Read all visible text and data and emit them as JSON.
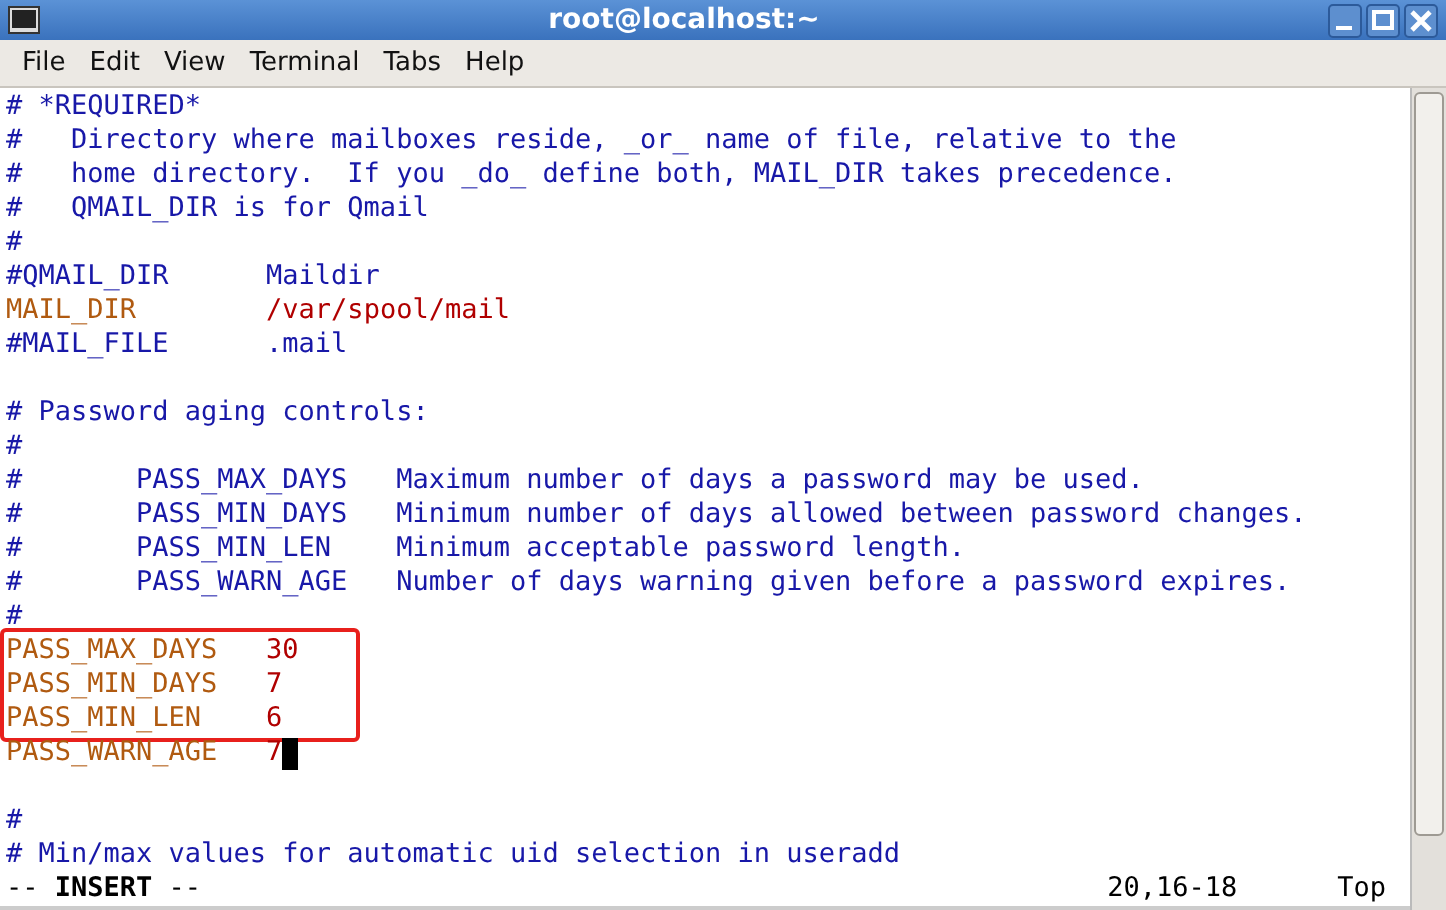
{
  "window": {
    "title": "root@localhost:~"
  },
  "menu": [
    {
      "label": "File"
    },
    {
      "label": "Edit"
    },
    {
      "label": "View"
    },
    {
      "label": "Terminal"
    },
    {
      "label": "Tabs"
    },
    {
      "label": "Help"
    }
  ],
  "blocks": [
    {
      "boxed": false,
      "lines": [
        {
          "kind": "code",
          "cursor": false,
          "segments": [
            {
              "kind": "comment",
              "text": "# *REQUIRED*"
            }
          ]
        },
        {
          "kind": "code",
          "cursor": false,
          "segments": [
            {
              "kind": "comment",
              "text": "#   Directory where mailboxes reside, _or_ name of file, relative to the"
            }
          ]
        },
        {
          "kind": "code",
          "cursor": false,
          "segments": [
            {
              "kind": "comment",
              "text": "#   home directory.  If you _do_ define both, MAIL_DIR takes precedence."
            }
          ]
        },
        {
          "kind": "code",
          "cursor": false,
          "segments": [
            {
              "kind": "comment",
              "text": "#   QMAIL_DIR is for Qmail"
            }
          ]
        },
        {
          "kind": "code",
          "cursor": false,
          "segments": [
            {
              "kind": "comment",
              "text": "#"
            }
          ]
        },
        {
          "kind": "code",
          "cursor": false,
          "segments": [
            {
              "kind": "comment",
              "text": "#QMAIL_DIR      Maildir"
            }
          ]
        },
        {
          "kind": "code",
          "cursor": false,
          "segments": [
            {
              "kind": "key",
              "text": "MAIL_DIR        "
            },
            {
              "kind": "value",
              "text": "/var/spool/mail"
            }
          ]
        },
        {
          "kind": "code",
          "cursor": false,
          "segments": [
            {
              "kind": "comment",
              "text": "#MAIL_FILE      .mail"
            }
          ]
        },
        {
          "kind": "blank"
        },
        {
          "kind": "code",
          "cursor": false,
          "segments": [
            {
              "kind": "comment",
              "text": "# Password aging controls:"
            }
          ]
        },
        {
          "kind": "code",
          "cursor": false,
          "segments": [
            {
              "kind": "comment",
              "text": "#"
            }
          ]
        },
        {
          "kind": "code",
          "cursor": false,
          "segments": [
            {
              "kind": "comment",
              "text": "#       PASS_MAX_DAYS   Maximum number of days a password may be used."
            }
          ]
        },
        {
          "kind": "code",
          "cursor": false,
          "segments": [
            {
              "kind": "comment",
              "text": "#       PASS_MIN_DAYS   Minimum number of days allowed between password changes."
            }
          ]
        },
        {
          "kind": "code",
          "cursor": false,
          "segments": [
            {
              "kind": "comment",
              "text": "#       PASS_MIN_LEN    Minimum acceptable password length."
            }
          ]
        },
        {
          "kind": "code",
          "cursor": false,
          "segments": [
            {
              "kind": "comment",
              "text": "#       PASS_WARN_AGE   Number of days warning given before a password expires."
            }
          ]
        },
        {
          "kind": "code",
          "cursor": false,
          "segments": [
            {
              "kind": "comment",
              "text": "#"
            }
          ]
        }
      ]
    },
    {
      "boxed": true,
      "lines": [
        {
          "kind": "code",
          "cursor": false,
          "segments": [
            {
              "kind": "key",
              "text": "PASS_MAX_DAYS   "
            },
            {
              "kind": "value",
              "text": "30"
            }
          ]
        },
        {
          "kind": "code",
          "cursor": false,
          "segments": [
            {
              "kind": "key",
              "text": "PASS_MIN_DAYS   "
            },
            {
              "kind": "value",
              "text": "7"
            }
          ]
        },
        {
          "kind": "code",
          "cursor": false,
          "segments": [
            {
              "kind": "key",
              "text": "PASS_MIN_LEN    "
            },
            {
              "kind": "value",
              "text": "6"
            }
          ]
        }
      ]
    },
    {
      "boxed": false,
      "lines": [
        {
          "kind": "code",
          "cursor": true,
          "segments": [
            {
              "kind": "key",
              "text": "PASS_WARN_AGE   "
            },
            {
              "kind": "value",
              "text": "7"
            }
          ]
        },
        {
          "kind": "blank"
        },
        {
          "kind": "code",
          "cursor": false,
          "segments": [
            {
              "kind": "comment",
              "text": "#"
            }
          ]
        },
        {
          "kind": "code",
          "cursor": false,
          "segments": [
            {
              "kind": "comment",
              "text": "# Min/max values for automatic uid selection in useradd"
            }
          ]
        }
      ]
    }
  ],
  "status": {
    "mode_prefix": "--",
    "mode": "INSERT",
    "mode_suffix": "--",
    "position": "20,16-18",
    "scroll": "Top"
  }
}
